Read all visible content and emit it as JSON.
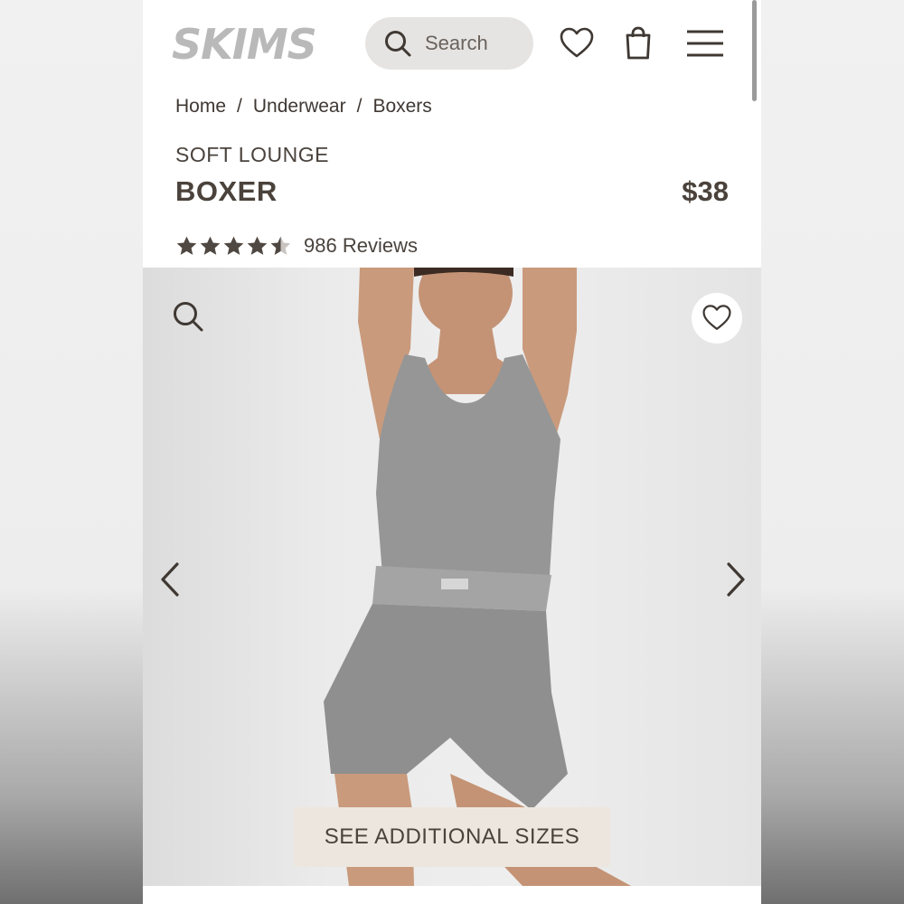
{
  "header": {
    "brand": "SKIMS",
    "search_label": "Search",
    "icons": [
      "search-icon",
      "heart-icon",
      "shopping-bag-icon",
      "menu-icon"
    ]
  },
  "breadcrumb": [
    "Home",
    "Underwear",
    "Boxers"
  ],
  "product": {
    "collection": "SOFT LOUNGE",
    "name": "BOXER",
    "price": "$38",
    "rating": 4.5,
    "reviews": "986 Reviews"
  },
  "gallery": {
    "see_sizes": "SEE ADDITIONAL SIZES",
    "icons": [
      "zoom-icon",
      "heart-icon",
      "chevron-left-icon",
      "chevron-right-icon"
    ],
    "slide_count": 5,
    "active_slide": 2
  },
  "colors": {
    "text": "#4a423b",
    "search_bg": "#e6e4e2",
    "button_bg": "#ede6de",
    "logo": "#b9b9b9",
    "garment": "#8f8f8f"
  }
}
